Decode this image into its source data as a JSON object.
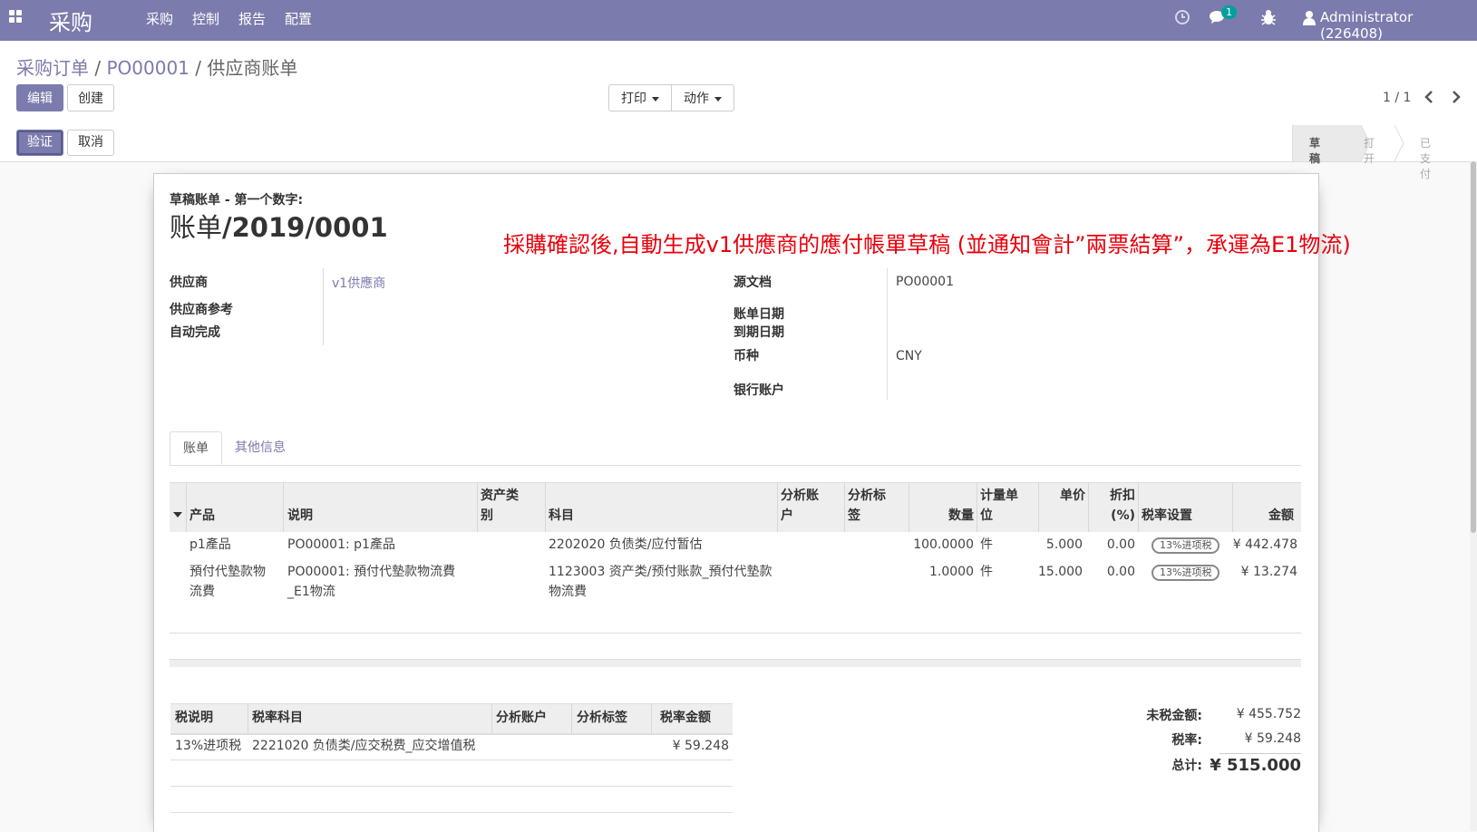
{
  "topbar": {
    "app_title": "采购",
    "menu": [
      "采购",
      "控制",
      "报告",
      "配置"
    ],
    "chat_count": "1",
    "user": "Administrator (226408)",
    "colors": {
      "bar": "#7c7bad",
      "badge": "#00a09d"
    }
  },
  "breadcrumb": {
    "first": "采购订单",
    "sep": "/",
    "second": "PO00001",
    "current": "供应商账单"
  },
  "buttons": {
    "edit": "编辑",
    "create": "创建",
    "print": "打印",
    "action": "动作",
    "validate": "验证",
    "cancel": "取消"
  },
  "pager": {
    "value": "1 / 1"
  },
  "status_stages": [
    "草稿",
    "打开",
    "已支付"
  ],
  "form": {
    "subtitle": "草稿账单 - 第一个数字:",
    "title_prefix": "账单",
    "title_number": "/2019/0001",
    "annotation": "採購確認後,自動生成v1供應商的應付帳單草稿 (並通知會計”兩票結算”，承運為E1物流)",
    "left_fields": [
      {
        "label": "供应商",
        "value": "v1供應商"
      },
      {
        "label": "供应商参考",
        "value": ""
      },
      {
        "label": "自动完成",
        "value": ""
      }
    ],
    "right_fields": [
      {
        "label": "源文档",
        "value": "PO00001"
      },
      {
        "label": "账单日期",
        "value": ""
      },
      {
        "label": "到期日期",
        "value": ""
      },
      {
        "label": "币种",
        "value": "CNY"
      },
      {
        "label": "银行账户",
        "value": ""
      }
    ]
  },
  "tabs": [
    "账单",
    "其他信息"
  ],
  "lines": {
    "headers": {
      "product": "产品",
      "desc": "说明",
      "asset1": "资产类",
      "asset2": "别",
      "account": "科目",
      "analytic1": "分析账",
      "analytic2": "户",
      "tags1": "分析标",
      "tags2": "签",
      "qty": "数量",
      "uom1": "计量单",
      "uom2": "位",
      "price": "单价",
      "disc1": "折扣",
      "disc2": "(%)",
      "tax": "税率设置",
      "amount": "金额"
    },
    "rows": [
      {
        "product": "p1產品",
        "product2": "",
        "desc": "PO00001: p1產品",
        "desc2": "",
        "account": "2202020 负债类/应付暂估",
        "account2": "",
        "qty": "100.0000",
        "uom": "件",
        "price": "5.000",
        "disc": "0.00",
        "tax": "13%进项税",
        "amount": "¥ 442.478"
      },
      {
        "product": "預付代墊款物",
        "product2": "流費",
        "desc": "PO00001: 預付代墊款物流費",
        "desc2": "_E1物流",
        "account": "1123003 资产类/预付账款_預付代墊款",
        "account2": "物流費",
        "qty": "1.0000",
        "uom": "件",
        "price": "15.000",
        "disc": "0.00",
        "tax": "13%进项税",
        "amount": "¥ 13.274"
      }
    ]
  },
  "tax_table": {
    "headers": {
      "desc": "税说明",
      "account": "税率科目",
      "analytic": "分析账户",
      "tags": "分析标签",
      "amount": "税率金额"
    },
    "row": {
      "desc": "13%进项税",
      "account": "2221020 负债类/应交税费_应交增值税",
      "amount": "¥ 59.248"
    }
  },
  "totals": {
    "untaxed_label": "未税金额:",
    "untaxed": "¥ 455.752",
    "tax_label": "税率:",
    "tax": "¥ 59.248",
    "total_label": "总计:",
    "total": "¥ 515.000"
  }
}
